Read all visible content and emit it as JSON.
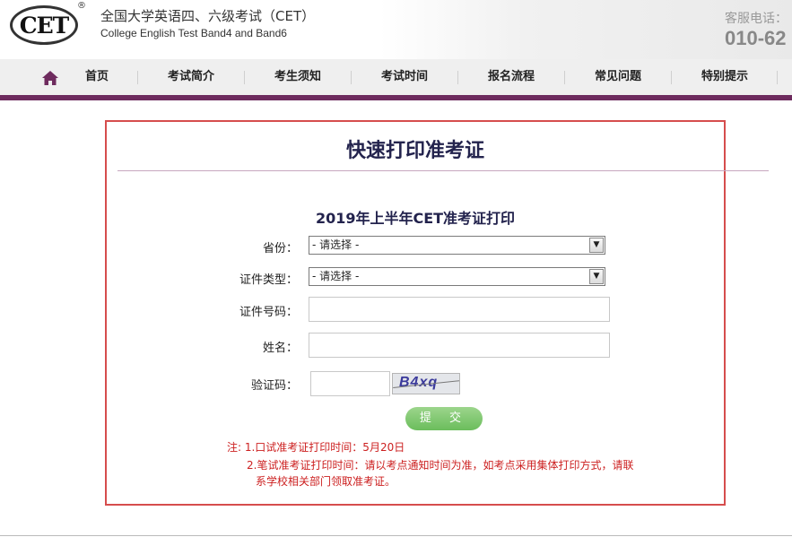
{
  "header": {
    "logo_text": "CET",
    "logo_reg": "®",
    "site_title": "全国大学英语四、六级考试（CET）",
    "site_subtitle": "College English Test Band4 and Band6",
    "hotline_label": "客服电话：",
    "hotline_number": "010-62"
  },
  "nav": {
    "home_icon": "home-icon",
    "items": [
      {
        "label": "首页"
      },
      {
        "label": "考试简介"
      },
      {
        "label": "考生须知"
      },
      {
        "label": "考试时间"
      },
      {
        "label": "报名流程"
      },
      {
        "label": "常见问题"
      },
      {
        "label": "特别提示"
      }
    ],
    "accent_color": "#6e2b5e"
  },
  "panel": {
    "title": "快速打印准考证",
    "form_heading": "2019年上半年CET准考证打印",
    "border_color": "#d64d4d",
    "fields": {
      "province": {
        "label": "省份：",
        "value": "- 请选择 -"
      },
      "id_type": {
        "label": "证件类型：",
        "value": "- 请选择 -"
      },
      "id_number": {
        "label": "证件号码：",
        "value": ""
      },
      "name": {
        "label": "姓名：",
        "value": ""
      },
      "captcha": {
        "label": "验证码：",
        "value": "",
        "image_text": "B4xq"
      }
    },
    "submit_label": "提 交",
    "notes": [
      "注: 1.口试准考证打印时间：5月20日",
      "2.笔试准考证打印时间：请以考点通知时间为准，如考点采用集体打印方式，请联",
      "系学校相关部门领取准考证。"
    ],
    "note_color": "#cc1f1f"
  }
}
